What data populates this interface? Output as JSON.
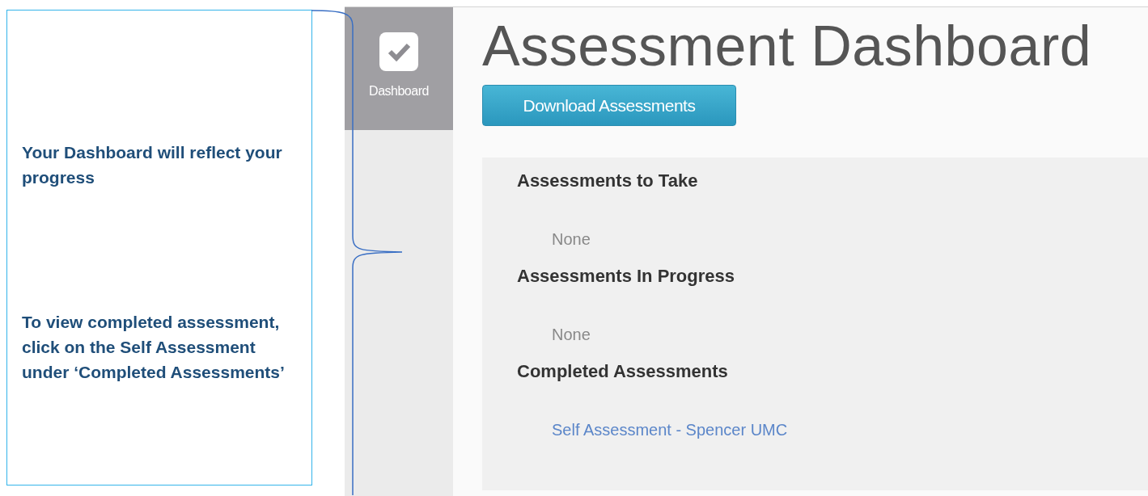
{
  "callout": {
    "notes": [
      "Your Dashboard will reflect your progress",
      "To view completed assessment, click on the Self Assessment under ‘Completed Assessments’"
    ]
  },
  "sidebar": {
    "items": [
      {
        "label": "Dashboard",
        "selected": true
      }
    ]
  },
  "page": {
    "title": "Assessment Dashboard",
    "button": "Download Assessments"
  },
  "sections": [
    {
      "heading": "Assessments to Take",
      "items": [
        {
          "kind": "empty",
          "text": "None"
        }
      ]
    },
    {
      "heading": "Assessments In Progress",
      "items": [
        {
          "kind": "empty",
          "text": "None"
        }
      ]
    },
    {
      "heading": "Completed Assessments",
      "items": [
        {
          "kind": "link",
          "text": "Self Assessment - Spencer UMC"
        }
      ]
    }
  ]
}
